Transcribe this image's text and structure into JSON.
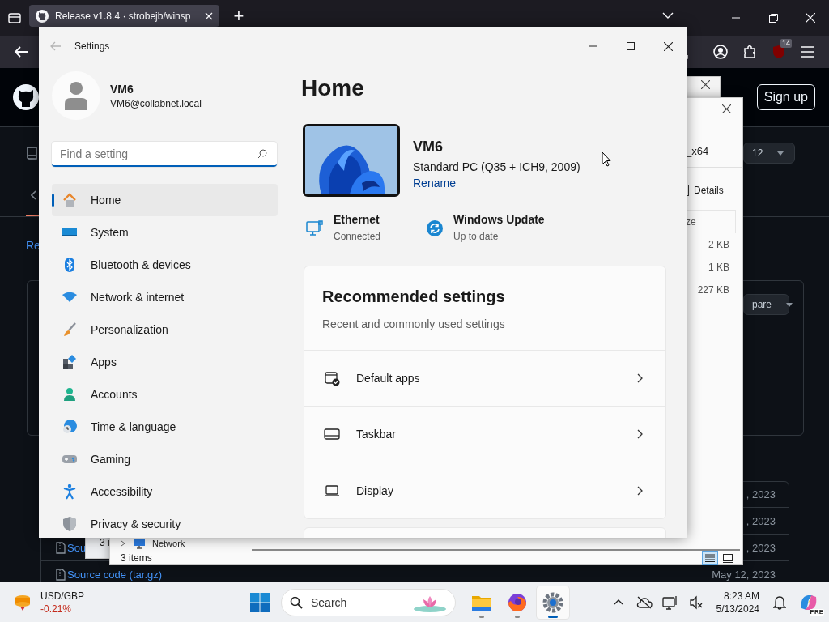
{
  "browser": {
    "tabs": [
      {
        "title": "Release v1.8.4 · strobejb/winsp",
        "selected": true
      }
    ],
    "new_tab": "+",
    "extension_badge": "14",
    "page": {
      "sign_up": "Sign up",
      "tab_fragment": "Re",
      "branch_fragment": "12",
      "compare_fragment": "pare",
      "assets": [
        {
          "date": ", 2023"
        },
        {
          "date": ", 2023"
        },
        {
          "name": "Sou",
          "date": ", 2023"
        },
        {
          "name": "Source code (tar.gz)",
          "date": "May 12, 2023"
        }
      ]
    }
  },
  "back_window": {
    "status_fragment": "3 i"
  },
  "explorer": {
    "address_fragment": "_x64",
    "details": "Details",
    "column_fragment": "ze",
    "sizes": [
      "2 KB",
      "1 KB",
      "227 KB"
    ],
    "nav": [
      {
        "label": "Network",
        "expanded": false
      }
    ],
    "status": "3 items",
    "views": [
      {
        "selected": true
      },
      {
        "selected": false
      }
    ]
  },
  "settings": {
    "title": "Settings",
    "user": {
      "name": "VM6",
      "email": "VM6@collabnet.local"
    },
    "search": {
      "placeholder": "Find a setting"
    },
    "nav": [
      {
        "label": "Home",
        "selected": true
      },
      {
        "label": "System",
        "selected": false
      },
      {
        "label": "Bluetooth & devices",
        "selected": false
      },
      {
        "label": "Network & internet",
        "selected": false
      },
      {
        "label": "Personalization",
        "selected": false
      },
      {
        "label": "Apps",
        "selected": false
      },
      {
        "label": "Accounts",
        "selected": false
      },
      {
        "label": "Time & language",
        "selected": false
      },
      {
        "label": "Gaming",
        "selected": false
      },
      {
        "label": "Accessibility",
        "selected": false
      },
      {
        "label": "Privacy & security",
        "selected": false
      }
    ],
    "heading": "Home",
    "device": {
      "name": "VM6",
      "model": "Standard PC (Q35 + ICH9, 2009)",
      "rename": "Rename"
    },
    "status": [
      {
        "title": "Ethernet",
        "detail": "Connected"
      },
      {
        "title": "Windows Update",
        "detail": "Up to date"
      }
    ],
    "recommended": {
      "title": "Recommended settings",
      "subtitle": "Recent and commonly used settings",
      "items": [
        "Default apps",
        "Taskbar",
        "Display"
      ]
    }
  },
  "taskbar": {
    "widget": {
      "symbol": "USD/GBP",
      "change": "-0.21%"
    },
    "search": {
      "placeholder": "Search"
    },
    "apps": [
      {
        "selected": false
      },
      {
        "selected": false
      },
      {
        "selected": true
      }
    ],
    "time": "8:23 AM",
    "date": "5/13/2024",
    "copilot_badge": "PRE"
  }
}
